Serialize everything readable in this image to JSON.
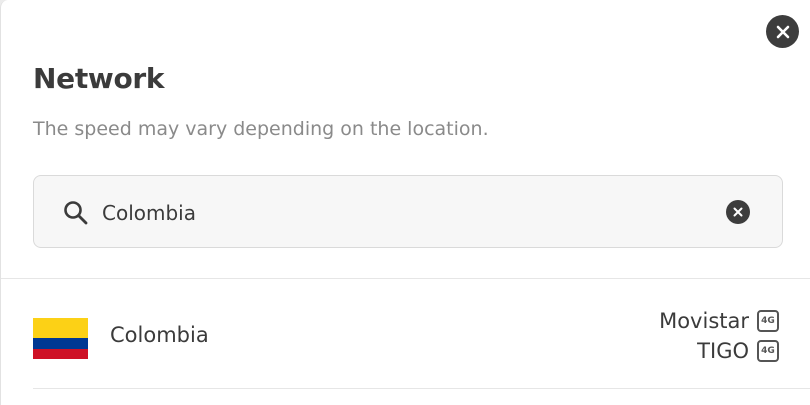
{
  "dialog": {
    "title": "Network",
    "subtitle": "The speed may vary depending on the location.",
    "close_icon": "close-icon"
  },
  "search": {
    "value": "Colombia",
    "icon": "search-icon",
    "clear_icon": "clear-icon"
  },
  "results": [
    {
      "country": "Colombia",
      "flag_colors": [
        "#fcd116",
        "#003893",
        "#ce1126"
      ],
      "operators": [
        {
          "name": "Movistar",
          "badge": "4G"
        },
        {
          "name": "TIGO",
          "badge": "4G"
        }
      ]
    }
  ],
  "colors": {
    "text": "#3b3b3b",
    "muted": "#8a8a8a",
    "icon_bg": "#3d3d3d"
  }
}
